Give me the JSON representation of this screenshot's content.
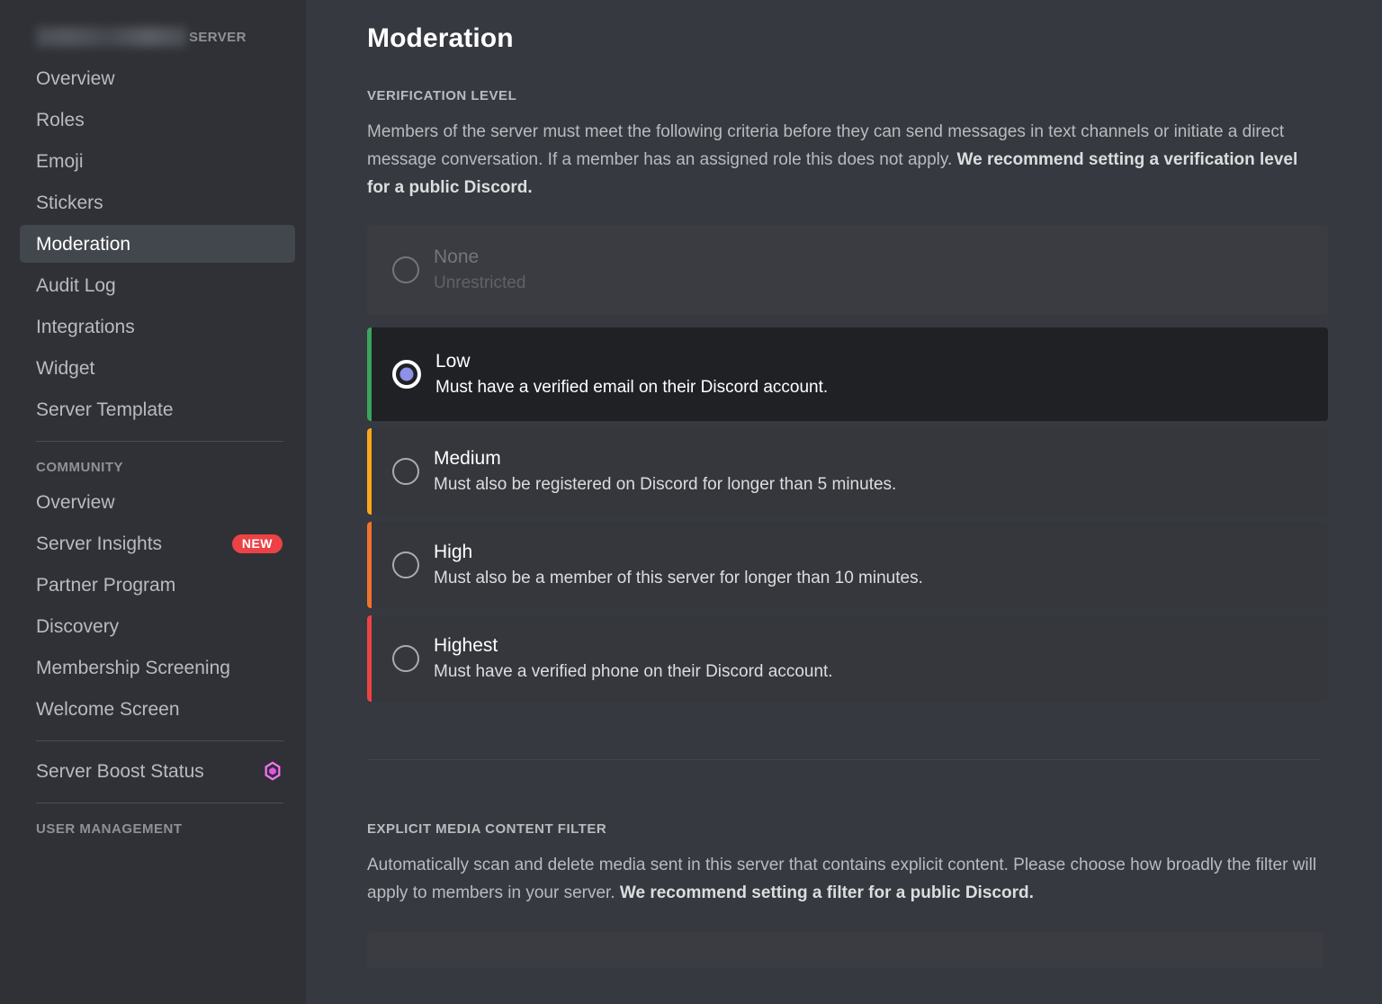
{
  "sidebar": {
    "server_header": {
      "server_name_redacted": "",
      "label": "SERVER"
    },
    "server_items": [
      {
        "label": "Overview",
        "active": false
      },
      {
        "label": "Roles",
        "active": false
      },
      {
        "label": "Emoji",
        "active": false
      },
      {
        "label": "Stickers",
        "active": false
      },
      {
        "label": "Moderation",
        "active": true
      },
      {
        "label": "Audit Log",
        "active": false
      },
      {
        "label": "Integrations",
        "active": false
      },
      {
        "label": "Widget",
        "active": false
      },
      {
        "label": "Server Template",
        "active": false
      }
    ],
    "community_label": "COMMUNITY",
    "community_items": [
      {
        "label": "Overview",
        "badge": ""
      },
      {
        "label": "Server Insights",
        "badge": "NEW"
      },
      {
        "label": "Partner Program",
        "badge": ""
      },
      {
        "label": "Discovery",
        "badge": ""
      },
      {
        "label": "Membership Screening",
        "badge": ""
      },
      {
        "label": "Welcome Screen",
        "badge": ""
      }
    ],
    "boost_item": {
      "label": "Server Boost Status",
      "icon": "boost-diamond-icon"
    },
    "user_management_label": "USER MANAGEMENT"
  },
  "main": {
    "page_title": "Moderation",
    "verification": {
      "section_label": "VERIFICATION LEVEL",
      "description_normal_1": "Members of the server must meet the following criteria before they can send messages in text channels or initiate a direct message conversation. If a member has an assigned role this does not apply. ",
      "description_bold": "We recommend setting a verification level for a public Discord.",
      "options": [
        {
          "title": "None",
          "subtitle": "Unrestricted",
          "selected": false,
          "disabled": true,
          "accent": ""
        },
        {
          "title": "Low",
          "subtitle": "Must have a verified email on their Discord account.",
          "selected": true,
          "disabled": false,
          "accent": "#3ba55d"
        },
        {
          "title": "Medium",
          "subtitle": "Must also be registered on Discord for longer than 5 minutes.",
          "selected": false,
          "disabled": false,
          "accent": "#faa81a"
        },
        {
          "title": "High",
          "subtitle": "Must also be a member of this server for longer than 10 minutes.",
          "selected": false,
          "disabled": false,
          "accent": "#f2722b"
        },
        {
          "title": "Highest",
          "subtitle": "Must have a verified phone on their Discord account.",
          "selected": false,
          "disabled": false,
          "accent": "#ed4245"
        }
      ]
    },
    "explicit_filter": {
      "section_label": "EXPLICIT MEDIA CONTENT FILTER",
      "description_normal_1": "Automatically scan and delete media sent in this server that contains explicit content. Please choose how broadly the filter will apply to members in your server. ",
      "description_bold": "We recommend setting a filter for a public Discord."
    }
  },
  "colors": {
    "sidebar_bg": "#2f3136",
    "main_bg": "#36393f",
    "active_item_bg": "#42464d",
    "option_bg": "#35373c",
    "selected_option_bg": "#202125",
    "radio_fill": "#8d91e8",
    "badge_new_bg": "#ed4245",
    "boost_pink": "#ff73fa"
  }
}
